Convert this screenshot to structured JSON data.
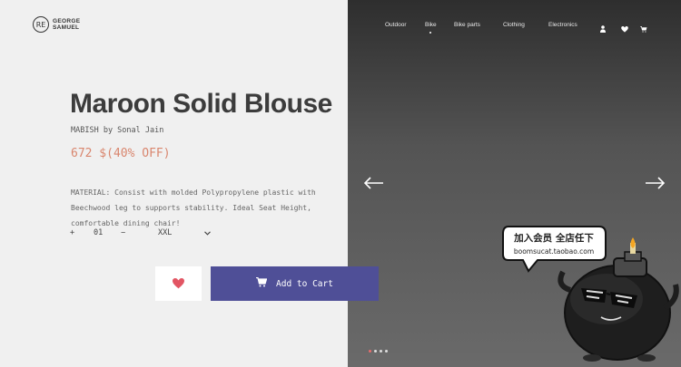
{
  "brand_logo": {
    "mark": "RE",
    "line1": "GEORGE",
    "line2": "SAMUEL"
  },
  "nav": {
    "items": [
      "Outdoor",
      "Bike",
      "Bike parts",
      "Clothing",
      "Electronics"
    ],
    "icons": [
      "user-icon",
      "heart-icon",
      "cart-icon"
    ]
  },
  "product": {
    "title": "Maroon Solid Blouse",
    "brand_line": "MABISH by Sonal Jain",
    "price": "672 $(40% OFF)",
    "description": "MATERIAL: Consist with molded Polypropylene plastic with Beechwood leg to supports stability. Ideal Seat Height, comfortable dining chair!",
    "qty_plus": "+",
    "qty_value": "01",
    "qty_minus": "−",
    "size_value": "XXL",
    "add_to_cart": "Add to Cart"
  },
  "carousel": {
    "prev": "←",
    "next": "→",
    "slide_count": 4,
    "active_index": 0
  },
  "promo": {
    "line1": "加入会员 全店任下",
    "line2": "boomsucat.taobao.com"
  },
  "colors": {
    "accent_button": "#4f4f97",
    "price": "#d9866e",
    "heart": "#e25563",
    "active_dot": "#e76d6d"
  }
}
